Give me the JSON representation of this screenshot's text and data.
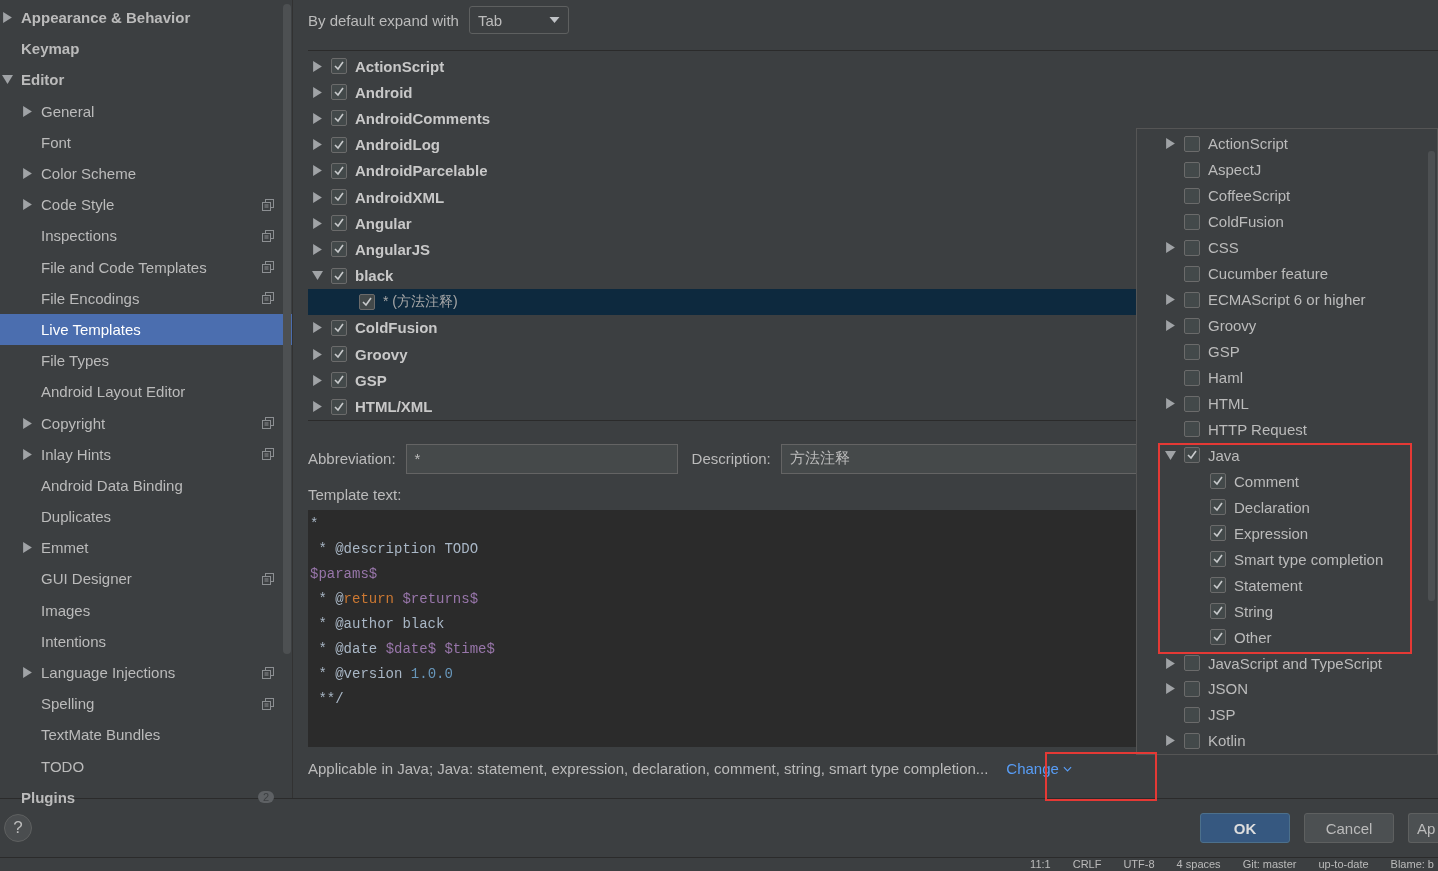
{
  "sidebar": {
    "items": [
      {
        "label": "Appearance & Behavior",
        "expandable": true,
        "expanded": false,
        "selected": false,
        "scope_icon": false
      },
      {
        "label": "Keymap",
        "expandable": false,
        "selected": false,
        "scope_icon": false
      },
      {
        "label": "Editor",
        "expandable": true,
        "expanded": true,
        "selected": false,
        "scope_icon": false,
        "children": [
          {
            "label": "General",
            "expandable": true,
            "expanded": false,
            "selected": false,
            "scope_icon": false
          },
          {
            "label": "Font",
            "expandable": false,
            "selected": false,
            "scope_icon": false
          },
          {
            "label": "Color Scheme",
            "expandable": true,
            "expanded": false,
            "selected": false,
            "scope_icon": false
          },
          {
            "label": "Code Style",
            "expandable": true,
            "expanded": false,
            "selected": false,
            "scope_icon": true
          },
          {
            "label": "Inspections",
            "expandable": false,
            "selected": false,
            "scope_icon": true
          },
          {
            "label": "File and Code Templates",
            "expandable": false,
            "selected": false,
            "scope_icon": true
          },
          {
            "label": "File Encodings",
            "expandable": false,
            "selected": false,
            "scope_icon": true
          },
          {
            "label": "Live Templates",
            "expandable": false,
            "selected": true,
            "scope_icon": false
          },
          {
            "label": "File Types",
            "expandable": false,
            "selected": false,
            "scope_icon": false
          },
          {
            "label": "Android Layout Editor",
            "expandable": false,
            "selected": false,
            "scope_icon": false
          },
          {
            "label": "Copyright",
            "expandable": true,
            "expanded": false,
            "selected": false,
            "scope_icon": true
          },
          {
            "label": "Inlay Hints",
            "expandable": true,
            "expanded": false,
            "selected": false,
            "scope_icon": true
          },
          {
            "label": "Android Data Binding",
            "expandable": false,
            "selected": false,
            "scope_icon": false
          },
          {
            "label": "Duplicates",
            "expandable": false,
            "selected": false,
            "scope_icon": false
          },
          {
            "label": "Emmet",
            "expandable": true,
            "expanded": false,
            "selected": false,
            "scope_icon": false
          },
          {
            "label": "GUI Designer",
            "expandable": false,
            "selected": false,
            "scope_icon": true
          },
          {
            "label": "Images",
            "expandable": false,
            "selected": false,
            "scope_icon": false
          },
          {
            "label": "Intentions",
            "expandable": false,
            "selected": false,
            "scope_icon": false
          },
          {
            "label": "Language Injections",
            "expandable": true,
            "expanded": false,
            "selected": false,
            "scope_icon": true
          },
          {
            "label": "Spelling",
            "expandable": false,
            "selected": false,
            "scope_icon": true
          },
          {
            "label": "TextMate Bundles",
            "expandable": false,
            "selected": false,
            "scope_icon": false
          },
          {
            "label": "TODO",
            "expandable": false,
            "selected": false,
            "scope_icon": false
          }
        ]
      },
      {
        "label": "Plugins",
        "expandable": false,
        "selected": false,
        "scope_icon": false,
        "count": "2"
      }
    ]
  },
  "expand_with": {
    "label": "By default expand with",
    "value": "Tab"
  },
  "template_groups": [
    {
      "label": "ActionScript",
      "checked": true,
      "expanded": false
    },
    {
      "label": "Android",
      "checked": true,
      "expanded": false
    },
    {
      "label": "AndroidComments",
      "checked": true,
      "expanded": false
    },
    {
      "label": "AndroidLog",
      "checked": true,
      "expanded": false
    },
    {
      "label": "AndroidParcelable",
      "checked": true,
      "expanded": false
    },
    {
      "label": "AndroidXML",
      "checked": true,
      "expanded": false
    },
    {
      "label": "Angular",
      "checked": true,
      "expanded": false
    },
    {
      "label": "AngularJS",
      "checked": true,
      "expanded": false
    },
    {
      "label": "black",
      "checked": true,
      "expanded": true,
      "children": [
        {
          "label": "* (方法注释)",
          "checked": true,
          "selected": true
        }
      ]
    },
    {
      "label": "ColdFusion",
      "checked": true,
      "expanded": false
    },
    {
      "label": "Groovy",
      "checked": true,
      "expanded": false
    },
    {
      "label": "GSP",
      "checked": true,
      "expanded": false
    },
    {
      "label": "HTML/XML",
      "checked": true,
      "expanded": false
    }
  ],
  "abbreviation": {
    "label": "Abbreviation:",
    "value": "*"
  },
  "description": {
    "label": "Description:",
    "value": "方法注释"
  },
  "template_text": {
    "label": "Template text:",
    "lines": [
      [
        {
          "kind": "plain",
          "text": "*"
        }
      ],
      [
        {
          "kind": "plain",
          "text": " * @description TODO"
        }
      ],
      [
        {
          "kind": "var",
          "text": "$params$"
        }
      ],
      [
        {
          "kind": "plain",
          "text": " * @"
        },
        {
          "kind": "keyword",
          "text": "return"
        },
        {
          "kind": "var",
          "text": " $returns$"
        }
      ],
      [
        {
          "kind": "plain",
          "text": " * @author black"
        }
      ],
      [
        {
          "kind": "plain",
          "text": " * @date "
        },
        {
          "kind": "var",
          "text": "$date$"
        },
        {
          "kind": "var",
          "text": " $time$"
        }
      ],
      [
        {
          "kind": "plain",
          "text": " * @version "
        },
        {
          "kind": "number",
          "text": "1.0.0"
        }
      ],
      [
        {
          "kind": "plain",
          "text": " **/"
        }
      ]
    ]
  },
  "applicable": {
    "text": "Applicable in Java; Java: statement, expression, declaration, comment, string, smart type completion...",
    "link": "Change"
  },
  "context_popup": {
    "items": [
      {
        "label": "ActionScript",
        "checked": false,
        "expandable": true,
        "expanded": false
      },
      {
        "label": "AspectJ",
        "checked": false,
        "expandable": false
      },
      {
        "label": "CoffeeScript",
        "checked": false,
        "expandable": false
      },
      {
        "label": "ColdFusion",
        "checked": false,
        "expandable": false
      },
      {
        "label": "CSS",
        "checked": false,
        "expandable": true,
        "expanded": false
      },
      {
        "label": "Cucumber feature",
        "checked": false,
        "expandable": false
      },
      {
        "label": "ECMAScript 6 or higher",
        "checked": false,
        "expandable": true,
        "expanded": false
      },
      {
        "label": "Groovy",
        "checked": false,
        "expandable": true,
        "expanded": false
      },
      {
        "label": "GSP",
        "checked": false,
        "expandable": false
      },
      {
        "label": "Haml",
        "checked": false,
        "expandable": false
      },
      {
        "label": "HTML",
        "checked": false,
        "expandable": true,
        "expanded": false
      },
      {
        "label": "HTTP Request",
        "checked": false,
        "expandable": false
      },
      {
        "label": "Java",
        "checked": true,
        "expandable": true,
        "expanded": true,
        "children": [
          {
            "label": "Comment",
            "checked": true
          },
          {
            "label": "Declaration",
            "checked": true
          },
          {
            "label": "Expression",
            "checked": true
          },
          {
            "label": "Smart type completion",
            "checked": true
          },
          {
            "label": "Statement",
            "checked": true
          },
          {
            "label": "String",
            "checked": true
          },
          {
            "label": "Other",
            "checked": true
          }
        ]
      },
      {
        "label": "JavaScript and TypeScript",
        "checked": false,
        "expandable": true,
        "expanded": false
      },
      {
        "label": "JSON",
        "checked": false,
        "expandable": true,
        "expanded": false
      },
      {
        "label": "JSP",
        "checked": false,
        "expandable": false
      },
      {
        "label": "Kotlin",
        "checked": false,
        "expandable": true,
        "expanded": false
      }
    ]
  },
  "buttons": [
    {
      "label": "OK",
      "kind": "primary"
    },
    {
      "label": "Cancel",
      "kind": "normal"
    },
    {
      "label": "Ap",
      "kind": "normal"
    }
  ],
  "help": "?",
  "status_bar": [
    "11:1",
    "CRLF",
    "UTF-8",
    "4 spaces",
    "Git: master",
    "up-to-date",
    "Blame: b"
  ]
}
